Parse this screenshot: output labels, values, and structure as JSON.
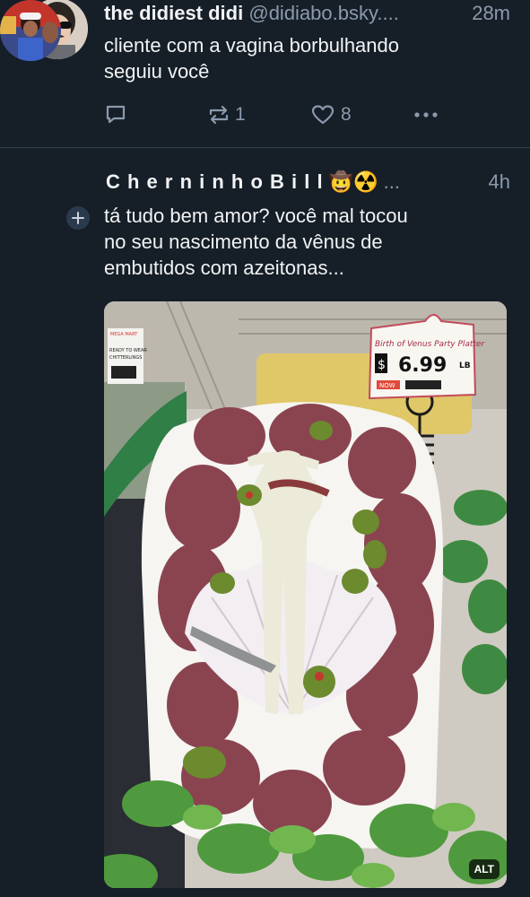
{
  "posts": [
    {
      "author_name": "the didiest didi",
      "author_handle": "@didiabo.bsky....",
      "time": "28m",
      "text_line1": "cliente com a vagina borbulhando",
      "text_line2": "seguiu você",
      "icons": {
        "reply": "reply-icon",
        "repost": "repost-icon",
        "like": "heart-icon",
        "more": "more-icon"
      },
      "reply_count": "",
      "repost_count": "1",
      "like_count": "8"
    },
    {
      "author_name": "C h e r n i n h o  B i l l",
      "author_emojis": "🤠☢️",
      "author_ellipsis": "...",
      "time": "4h",
      "text_line1": "tá tudo bem amor? você mal tocou",
      "text_line2": "no seu nascimento da vênus de",
      "text_line3": "embutidos com azeitonas...",
      "media": {
        "price_sign_title": "Birth of Venus Party Platter",
        "price_sign_currency": "$",
        "price_sign_price": "6.99",
        "price_sign_unit": "LB",
        "price_sign_badge": "NOW",
        "left_label_brand": "MEGA MART",
        "left_label_line1": "READY TO WEAR",
        "left_label_line2": "CHITTERLINGS",
        "alt_label": "ALT"
      }
    }
  ],
  "colors": {
    "background": "#161e27",
    "divider": "#2e4052",
    "muted_text": "#8a9aad",
    "primary_text": "#f1f3f5"
  }
}
